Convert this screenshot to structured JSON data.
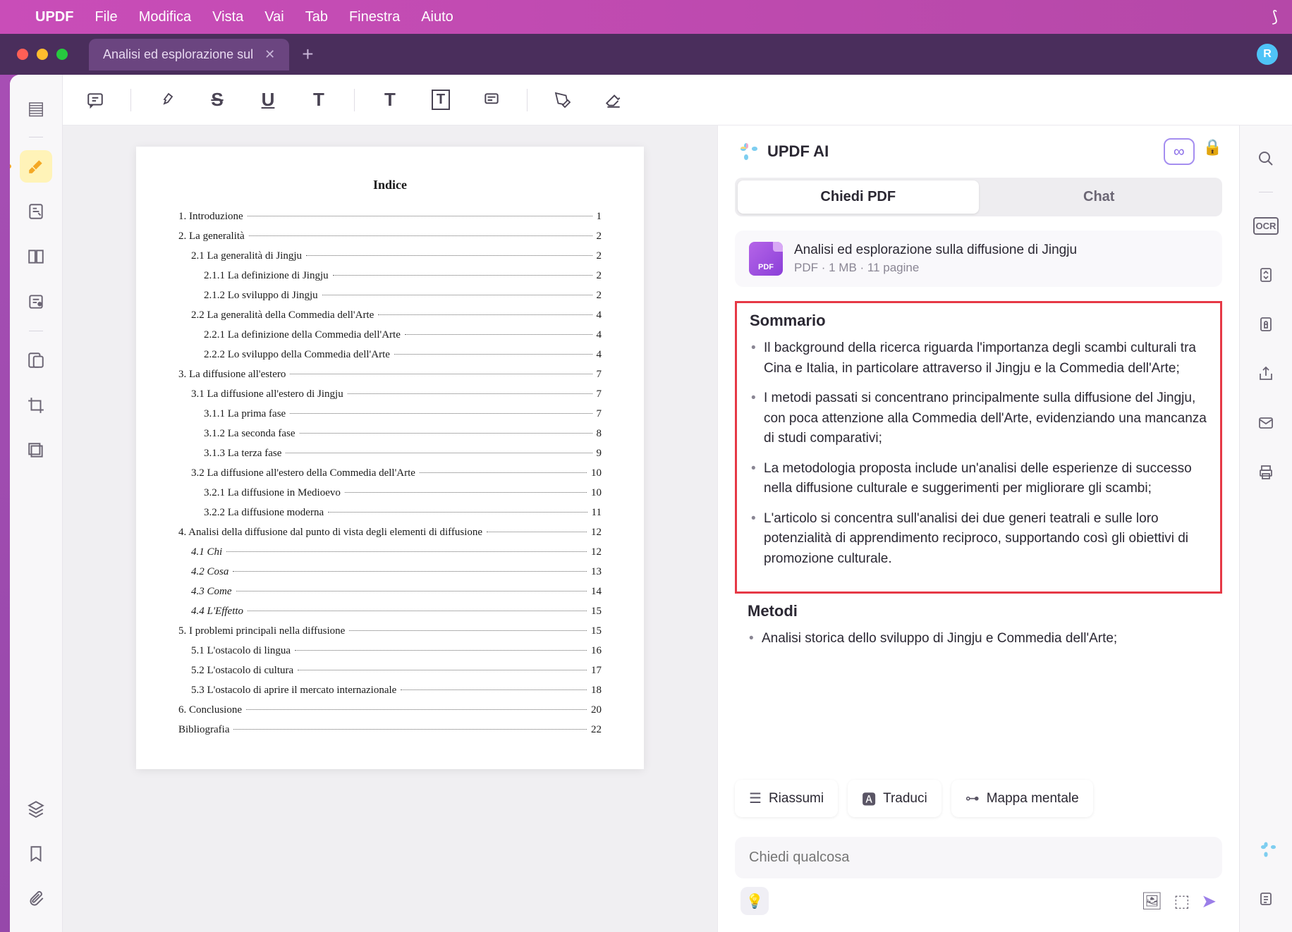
{
  "menubar": {
    "app_name": "UPDF",
    "items": [
      "File",
      "Modifica",
      "Vista",
      "Vai",
      "Tab",
      "Finestra",
      "Aiuto"
    ]
  },
  "window": {
    "tab_title": "Analisi ed esplorazione sul",
    "user_initial": "R"
  },
  "pdf": {
    "index_title": "Indice",
    "toc": [
      {
        "label": "1. Introduzione",
        "page": "1",
        "indent": 0
      },
      {
        "label": "2. La generalità",
        "page": "2",
        "indent": 0
      },
      {
        "label": "2.1 La generalità di Jingju",
        "page": "2",
        "indent": 1
      },
      {
        "label": "2.1.1 La definizione di Jingju",
        "page": "2",
        "indent": 2
      },
      {
        "label": "2.1.2 Lo sviluppo di Jingju",
        "page": "2",
        "indent": 2
      },
      {
        "label": "2.2 La generalità della Commedia dell'Arte",
        "page": "4",
        "indent": 1
      },
      {
        "label": "2.2.1 La definizione della Commedia dell'Arte",
        "page": "4",
        "indent": 2
      },
      {
        "label": "2.2.2 Lo sviluppo della Commedia dell'Arte",
        "page": "4",
        "indent": 2
      },
      {
        "label": "3. La diffusione all'estero",
        "page": "7",
        "indent": 0
      },
      {
        "label": "3.1 La diffusione all'estero di Jingju",
        "page": "7",
        "indent": 1
      },
      {
        "label": "3.1.1 La prima fase",
        "page": "7",
        "indent": 2
      },
      {
        "label": "3.1.2 La seconda fase",
        "page": "8",
        "indent": 2
      },
      {
        "label": "3.1.3 La terza fase",
        "page": "9",
        "indent": 2
      },
      {
        "label": "3.2 La diffusione all'estero della Commedia dell'Arte",
        "page": "10",
        "indent": 1
      },
      {
        "label": "3.2.1 La diffusione in Medioevo",
        "page": "10",
        "indent": 2
      },
      {
        "label": "3.2.2 La diffusione moderna",
        "page": "11",
        "indent": 2
      },
      {
        "label": "4. Analisi della diffusione dal punto di vista degli elementi di diffusione",
        "page": "12",
        "indent": 0
      },
      {
        "label": "4.1 Chi",
        "page": "12",
        "indent": 1,
        "italic": true
      },
      {
        "label": "4.2 Cosa",
        "page": "13",
        "indent": 1,
        "italic": true
      },
      {
        "label": "4.3 Come",
        "page": "14",
        "indent": 1,
        "italic": true
      },
      {
        "label": "4.4 L'Effetto",
        "page": "15",
        "indent": 1,
        "italic": true
      },
      {
        "label": "5. I problemi principali nella diffusione",
        "page": "15",
        "indent": 0
      },
      {
        "label": "5.1 L'ostacolo di lingua",
        "page": "16",
        "indent": 1
      },
      {
        "label": "5.2 L'ostacolo di cultura",
        "page": "17",
        "indent": 1
      },
      {
        "label": "5.3 L'ostacolo di aprire il mercato internazionale",
        "page": "18",
        "indent": 1
      },
      {
        "label": "6. Conclusione",
        "page": "20",
        "indent": 0
      },
      {
        "label": "Bibliografia",
        "page": "22",
        "indent": 0
      }
    ]
  },
  "ai": {
    "title": "UPDF AI",
    "tabs": {
      "ask": "Chiedi PDF",
      "chat": "Chat"
    },
    "doc": {
      "title": "Analisi ed esplorazione sulla diffusione di Jingju",
      "type": "PDF",
      "size": "1 MB",
      "pages": "11 pagine"
    },
    "summary_title": "Sommario",
    "summary_bullets": [
      "Il background della ricerca riguarda l'importanza degli scambi culturali tra Cina e Italia, in particolare attraverso il Jingju e la Commedia dell'Arte;",
      "I metodi passati si concentrano principalmente sulla diffusione del Jingju, con poca attenzione alla Commedia dell'Arte, evidenziando una mancanza di studi comparativi;",
      "La metodologia proposta include un'analisi delle esperienze di successo nella diffusione culturale e suggerimenti per migliorare gli scambi;",
      "L'articolo si concentra sull'analisi dei due generi teatrali e sulle loro potenzialità di apprendimento reciproco, supportando così gli obiettivi di promozione culturale."
    ],
    "methods_title": "Metodi",
    "methods_bullets": [
      "Analisi storica dello sviluppo di Jingju e Commedia dell'Arte;"
    ],
    "actions": {
      "summarize": "Riassumi",
      "translate": "Traduci",
      "mindmap": "Mappa mentale"
    },
    "input_placeholder": "Chiedi qualcosa"
  }
}
